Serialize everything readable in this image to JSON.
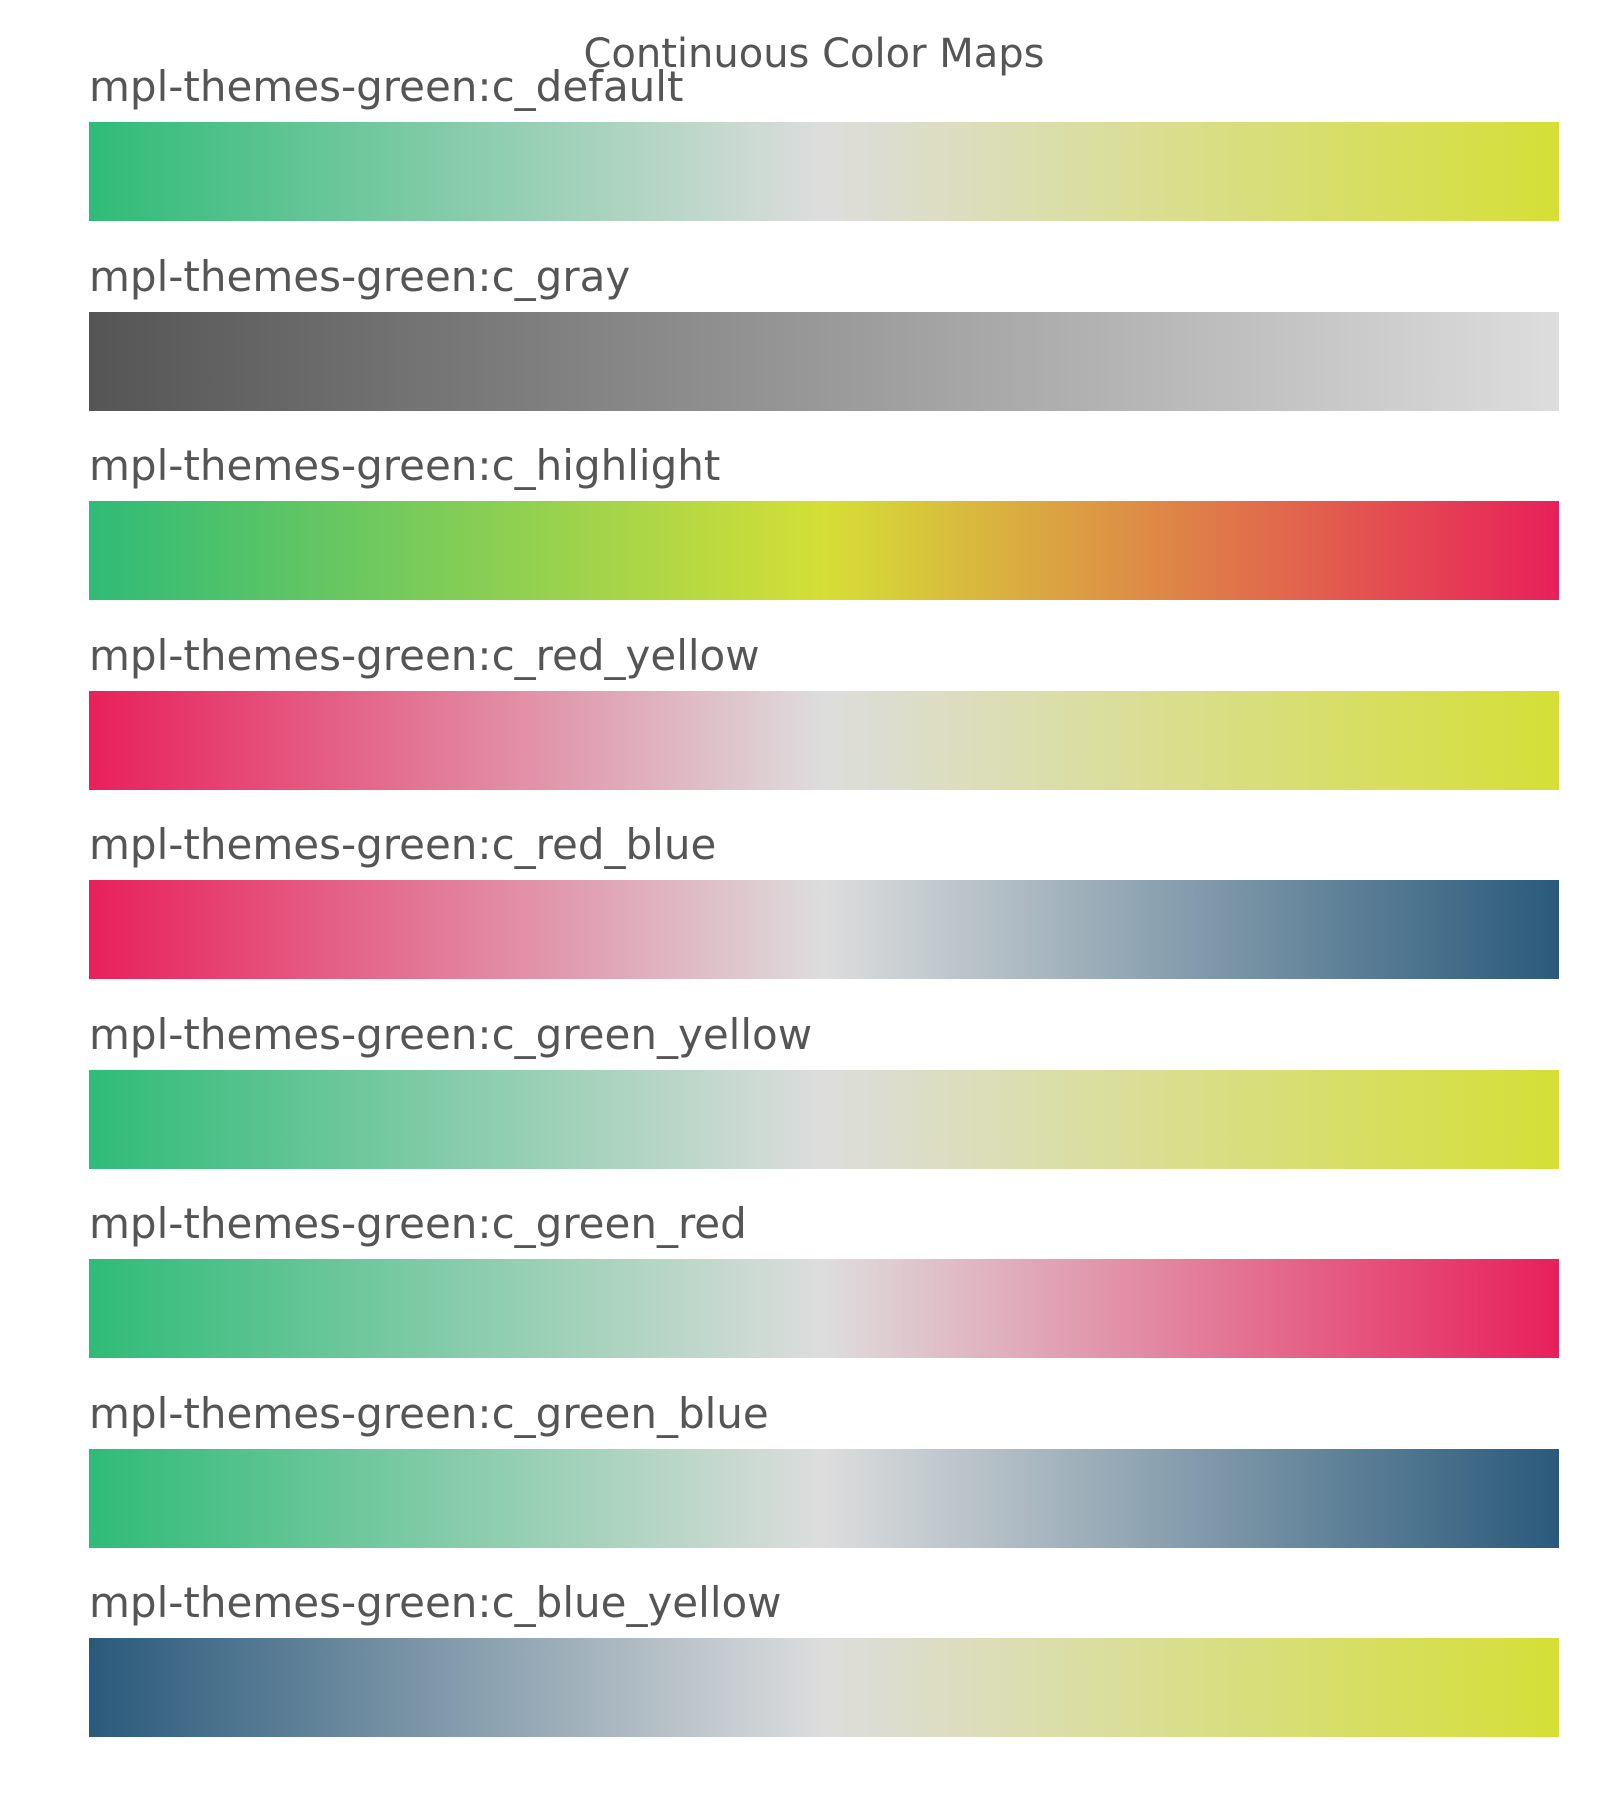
{
  "chart_data": {
    "type": "heatmap",
    "title": "Continuous Color Maps",
    "colormaps": [
      {
        "name": "mpl-themes-green:c_default",
        "colors": [
          "#2fbb77",
          "#dddddd",
          "#d5df36"
        ]
      },
      {
        "name": "mpl-themes-green:c_gray",
        "colors": [
          "#555555",
          "#dddddd"
        ]
      },
      {
        "name": "mpl-themes-green:c_highlight",
        "colors": [
          "#2fbb77",
          "#d5df36",
          "#e8205a"
        ]
      },
      {
        "name": "mpl-themes-green:c_red_yellow",
        "colors": [
          "#e8205a",
          "#dddddd",
          "#d5df36"
        ]
      },
      {
        "name": "mpl-themes-green:c_red_blue",
        "colors": [
          "#e8205a",
          "#dddddd",
          "#2a5a7b"
        ]
      },
      {
        "name": "mpl-themes-green:c_green_yellow",
        "colors": [
          "#2fbb77",
          "#dddddd",
          "#d5df36"
        ]
      },
      {
        "name": "mpl-themes-green:c_green_red",
        "colors": [
          "#2fbb77",
          "#dddddd",
          "#e8205a"
        ]
      },
      {
        "name": "mpl-themes-green:c_green_blue",
        "colors": [
          "#2fbb77",
          "#dddddd",
          "#2a5a7b"
        ]
      },
      {
        "name": "mpl-themes-green:c_blue_yellow",
        "colors": [
          "#2a5a7b",
          "#dddddd",
          "#d5df36"
        ]
      }
    ]
  }
}
